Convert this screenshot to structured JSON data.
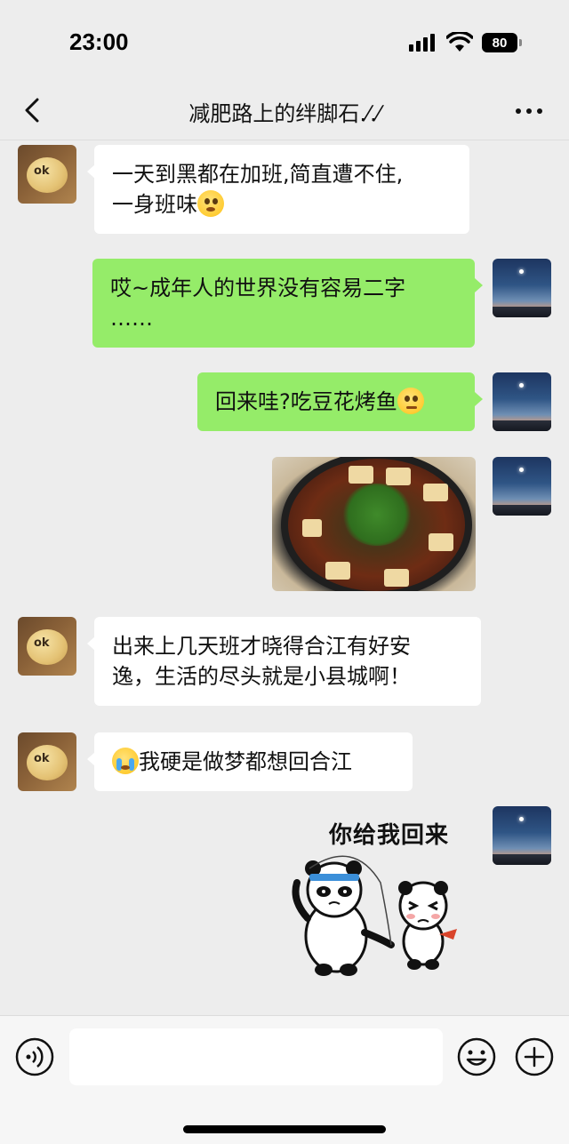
{
  "status_bar": {
    "time": "23:00",
    "battery": "80"
  },
  "header": {
    "title": "减肥路上的绊脚石.⁄.⁄"
  },
  "messages": [
    {
      "side": "left",
      "line1": "一天到黑都在加班,简直遭不住,",
      "line2": "一身班味"
    },
    {
      "side": "right",
      "line1": "哎~成年人的世界没有容易二字",
      "line2": "……"
    },
    {
      "side": "right",
      "text": "回来哇?吃豆花烤鱼"
    },
    {
      "side": "right",
      "type": "image"
    },
    {
      "side": "left",
      "line1": "出来上几天班才晓得合江有好安",
      "line2": "逸，生活的尽头就是小县城啊！"
    },
    {
      "side": "left",
      "text": "我硬是做梦都想回合江"
    },
    {
      "side": "right",
      "type": "sticker",
      "caption": "你给我回来"
    }
  ],
  "avatar_left": {
    "text": "ok"
  },
  "input_bar": {
    "placeholder": ""
  },
  "colors": {
    "background": "#ededed",
    "bubble_self": "#95ec69",
    "bubble_other": "#ffffff"
  }
}
